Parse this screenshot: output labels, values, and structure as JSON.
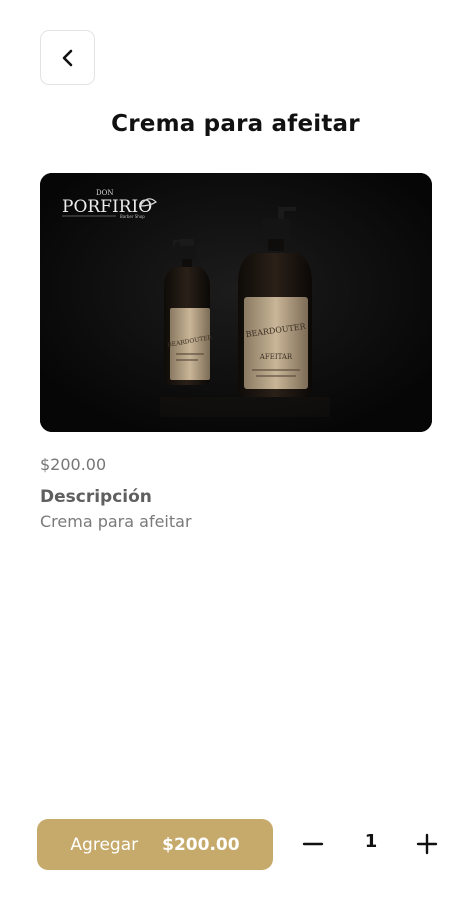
{
  "header": {
    "title": "Crema para afeitar"
  },
  "product": {
    "image_alt": "Crema para afeitar",
    "logo_text": "DON PORFIRIO",
    "logo_subtext": "Barber Shop",
    "bottle_label": "BEARDOUTER",
    "price": "$200.00",
    "description_heading": "Descripción",
    "description": "Crema para afeitar"
  },
  "cart": {
    "add_label": "Agregar",
    "add_price": "$200.00",
    "quantity": "1"
  },
  "colors": {
    "accent": "#c6aa6c",
    "image_bg": "#0c0c0c"
  },
  "icons": {
    "back": "chevron-left-icon",
    "decrement": "minus-icon",
    "increment": "plus-icon"
  }
}
